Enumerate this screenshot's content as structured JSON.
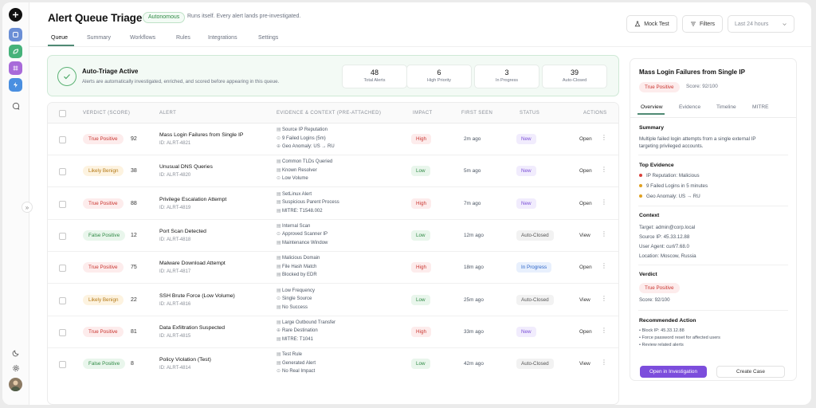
{
  "header": {
    "title": "Alert Queue Triage",
    "badge": "Autonomous",
    "subtitle": "Runs itself. Every alert lands pre-investigated.",
    "mock_test_label": "Mock Test",
    "filters_label": "Filters",
    "time_range": "Last 24 hours"
  },
  "tabs": [
    "Queue",
    "Summary",
    "Workflows",
    "Rules",
    "Integrations",
    "Settings"
  ],
  "banner": {
    "title": "Auto-Triage Active",
    "subtitle": "Alerts are automatically investigated, enriched, and scored before appearing in this queue.",
    "stats": [
      {
        "value": "48",
        "label": "Total Alerts"
      },
      {
        "value": "6",
        "label": "High Priority"
      },
      {
        "value": "3",
        "label": "In Progress"
      },
      {
        "value": "39",
        "label": "Auto-Closed"
      }
    ]
  },
  "table": {
    "headers": {
      "verdict": "VERDICT (SCORE)",
      "alert": "ALERT",
      "evidence": "EVIDENCE & CONTEXT (PRE-ATTACHED)",
      "impact": "IMPACT",
      "first_seen": "FIRST SEEN",
      "status": "STATUS",
      "actions": "ACTIONS"
    },
    "rows": [
      {
        "verdict": "True Positive",
        "vclass": "tp",
        "score": "92",
        "title": "Mass Login Failures from Single IP",
        "id": "ID: ALRT-4821",
        "evidence": [
          "Source IP Reputation",
          "9 Failed Logins (5m)",
          "Geo Anomaly: US → RU"
        ],
        "eicons": [
          "▤",
          "⊙",
          "⊕"
        ],
        "impact": "High",
        "iclass": "high",
        "seen": "2m ago",
        "status": "New",
        "sclass": "new",
        "action": "Open"
      },
      {
        "verdict": "Likely Benign",
        "vclass": "lb",
        "score": "38",
        "title": "Unusual DNS Queries",
        "id": "ID: ALRT-4820",
        "evidence": [
          "Common TLDs Queried",
          "Known Resolver",
          "Low Volume"
        ],
        "eicons": [
          "▤",
          "▤",
          "⊙"
        ],
        "impact": "Low",
        "iclass": "low",
        "seen": "5m ago",
        "status": "New",
        "sclass": "new",
        "action": "Open"
      },
      {
        "verdict": "True Positive",
        "vclass": "tp",
        "score": "88",
        "title": "Privilege Escalation Attempt",
        "id": "ID: ALRT-4819",
        "evidence": [
          "SetLinux Alert",
          "Suspicious Parent Process",
          "MITRE: T1548.002"
        ],
        "eicons": [
          "▤",
          "▤",
          "▤"
        ],
        "impact": "High",
        "iclass": "high",
        "seen": "7m ago",
        "status": "New",
        "sclass": "new",
        "action": "Open"
      },
      {
        "verdict": "False Positive",
        "vclass": "fp",
        "score": "12",
        "title": "Port Scan Detected",
        "id": "ID: ALRT-4818",
        "evidence": [
          "Internal Scan",
          "Approved Scanner IP",
          "Maintenance Window"
        ],
        "eicons": [
          "▤",
          "⊙",
          "▤"
        ],
        "impact": "Low",
        "iclass": "low",
        "seen": "12m ago",
        "status": "Auto-Closed",
        "sclass": "closed",
        "action": "View"
      },
      {
        "verdict": "True Positive",
        "vclass": "tp",
        "score": "75",
        "title": "Malware Download Attempt",
        "id": "ID: ALRT-4817",
        "evidence": [
          "Malicious Domain",
          "File Hash Match",
          "Blocked by EDR"
        ],
        "eicons": [
          "▤",
          "▤",
          "▤"
        ],
        "impact": "High",
        "iclass": "high",
        "seen": "18m ago",
        "status": "In Progress",
        "sclass": "prog",
        "action": "Open"
      },
      {
        "verdict": "Likely Benign",
        "vclass": "lb",
        "score": "22",
        "title": "SSH Brute Force (Low Volume)",
        "id": "ID: ALRT-4816",
        "evidence": [
          "Low Frequency",
          "Single Source",
          "No Success"
        ],
        "eicons": [
          "▤",
          "⊙",
          "▤"
        ],
        "impact": "Low",
        "iclass": "low",
        "seen": "25m ago",
        "status": "Auto-Closed",
        "sclass": "closed",
        "action": "View"
      },
      {
        "verdict": "True Positive",
        "vclass": "tp",
        "score": "81",
        "title": "Data Exfiltration Suspected",
        "id": "ID: ALRT-4815",
        "evidence": [
          "Large Outbound Transfer",
          "Rare Destination",
          "MITRE: T1041"
        ],
        "eicons": [
          "▤",
          "⊕",
          "▤"
        ],
        "impact": "High",
        "iclass": "high",
        "seen": "33m ago",
        "status": "New",
        "sclass": "new",
        "action": "Open"
      },
      {
        "verdict": "False Positive",
        "vclass": "fp",
        "score": "8",
        "title": "Policy Violation (Test)",
        "id": "ID: ALRT-4814",
        "evidence": [
          "Test Rule",
          "Generated Alert",
          "No Real Impact"
        ],
        "eicons": [
          "▤",
          "▤",
          "⊙"
        ],
        "impact": "Low",
        "iclass": "low",
        "seen": "42m ago",
        "status": "Auto-Closed",
        "sclass": "closed",
        "action": "View"
      }
    ]
  },
  "panel": {
    "title": "Mass Login Failures from Single IP",
    "verdict": "True Positive",
    "score": "Score: 92/100",
    "tabs": [
      "Overview",
      "Evidence",
      "Timeline",
      "MITRE"
    ],
    "summary_h": "Summary",
    "summary": [
      "Multiple failed login attempts from a single external IP",
      "targeting privileged accounts."
    ],
    "evidence_h": "Top Evidence",
    "evidence": [
      {
        "text": "IP Reputation: Malicious",
        "color": "#d9413b"
      },
      {
        "text": "9 Failed Logins in 5 minutes",
        "color": "#e0a021"
      },
      {
        "text": "Geo Anomaly: US → RU",
        "color": "#e0a021"
      }
    ],
    "context_h": "Context",
    "context": [
      "Target: admin@corp.local",
      "Source IP: 45.33.12.88",
      "User Agent: curl/7.68.0",
      "Location: Moscow, Russia"
    ],
    "verdict_h": "Verdict",
    "verdict_score": "Score: 92/100",
    "rec_h": "Recommended Action",
    "rec": [
      "Block IP: 45.33.12.88",
      "Force password reset for affected users",
      "Review related alerts"
    ],
    "primary_btn": "Open in Investigation",
    "secondary_btn": "Create Case"
  },
  "colors": {
    "accent": "#7c4ddc",
    "brand_green": "#4f8a74",
    "danger": "#c9342f"
  }
}
